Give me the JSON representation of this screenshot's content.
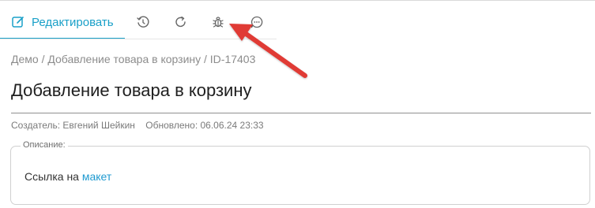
{
  "tabs": {
    "edit_label": "Редактировать",
    "icons": [
      "edit-icon",
      "history-icon",
      "refresh-icon",
      "bug-icon",
      "comment-icon"
    ]
  },
  "breadcrumb": "Демо / Добавление товара в корзину / ID-17403",
  "page_title": "Добавление товара в корзину",
  "meta": {
    "author": "Создатель: Евгений Шейкин",
    "updated": "Обновлено: 06.06.24 23:33"
  },
  "description": {
    "legend": "Описание:",
    "text": "Ссылка на ",
    "link_text": "макет"
  },
  "colors": {
    "accent": "#1aa0c8",
    "link": "#1f9ad0",
    "annotation_arrow": "#e03a35"
  }
}
